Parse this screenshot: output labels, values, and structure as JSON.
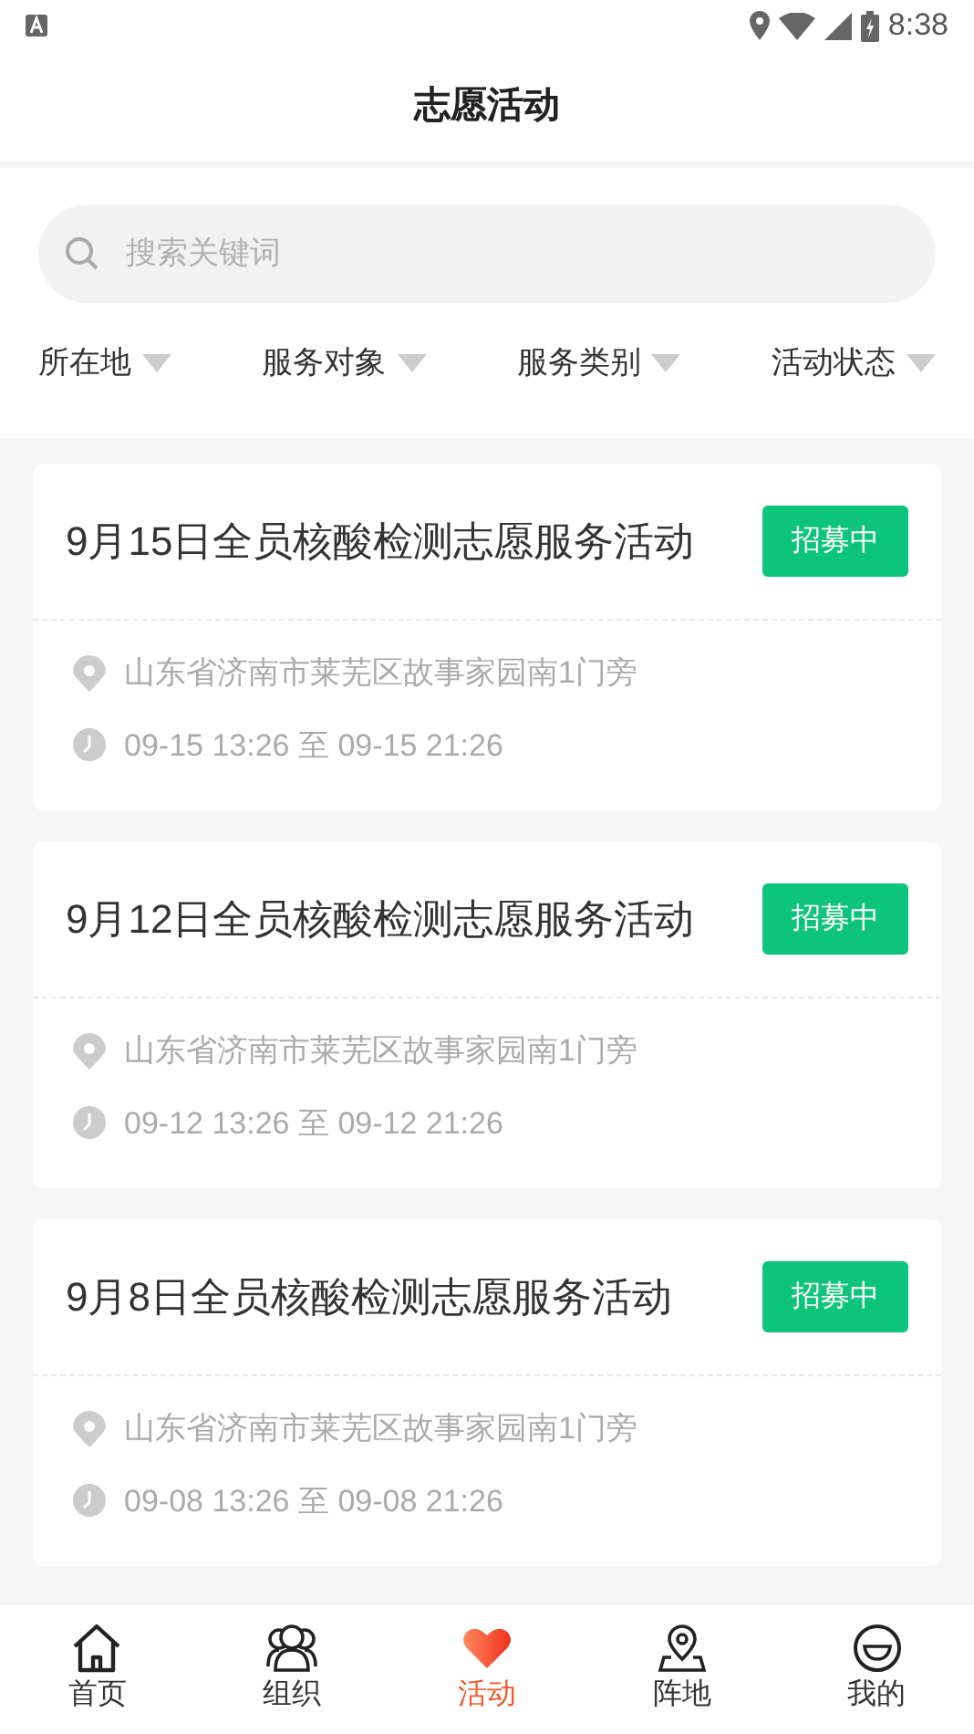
{
  "status_bar": {
    "time": "8:38"
  },
  "header": {
    "title": "志愿活动"
  },
  "search": {
    "placeholder": "搜索关键词"
  },
  "filters": [
    {
      "label": "所在地"
    },
    {
      "label": "服务对象"
    },
    {
      "label": "服务类别"
    },
    {
      "label": "活动状态"
    }
  ],
  "activities": [
    {
      "title": "9月15日全员核酸检测志愿服务活动",
      "status": "招募中",
      "address": "山东省济南市莱芜区故事家园南1门旁",
      "time": "09-15 13:26 至 09-15 21:26"
    },
    {
      "title": "9月12日全员核酸检测志愿服务活动",
      "status": "招募中",
      "address": "山东省济南市莱芜区故事家园南1门旁",
      "time": "09-12 13:26 至 09-12 21:26"
    },
    {
      "title": "9月8日全员核酸检测志愿服务活动",
      "status": "招募中",
      "address": "山东省济南市莱芜区故事家园南1门旁",
      "time": "09-08 13:26 至 09-08 21:26"
    }
  ],
  "tab_bar": [
    {
      "label": "首页",
      "kind": "home",
      "selected": false
    },
    {
      "label": "组织",
      "kind": "group",
      "selected": false
    },
    {
      "label": "活动",
      "kind": "heart",
      "selected": true
    },
    {
      "label": "阵地",
      "kind": "pin",
      "selected": false
    },
    {
      "label": "我的",
      "kind": "smile",
      "selected": false
    }
  ]
}
